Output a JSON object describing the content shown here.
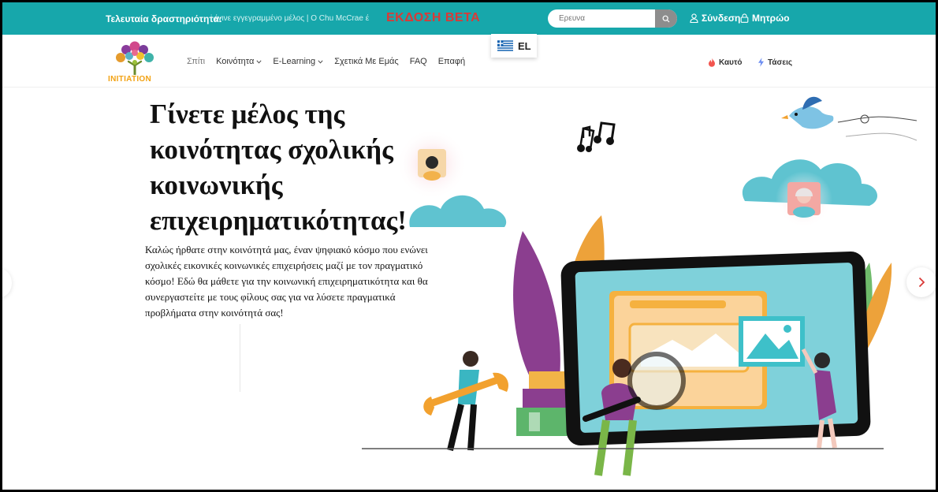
{
  "topbar": {
    "activity_label": "Τελευταία δραστηριότητα:",
    "activity_text": "i έγινε εγγεγραμμένο μέλος | O Chu McCrae έ",
    "beta_label": "ΕΚΔΟΣΗ BETA",
    "search_placeholder": "Ερευνα",
    "login_label": "Σύνδεση",
    "register_label": "Μητρώο"
  },
  "language": {
    "code": "EL"
  },
  "nav": {
    "logo_text": "INITIATION",
    "items": [
      {
        "label": "Σπίτι",
        "dropdown": false
      },
      {
        "label": "Κοινότητα",
        "dropdown": true
      },
      {
        "label": "E-Learning",
        "dropdown": true
      },
      {
        "label": "Σχετικά Με Εμάς",
        "dropdown": false
      },
      {
        "label": "FAQ",
        "dropdown": false
      },
      {
        "label": "Επαφή",
        "dropdown": false
      }
    ],
    "hot_label": "Καυτό",
    "trends_label": "Τάσεις"
  },
  "hero": {
    "title_lines": [
      "Γίνετε μέλος της",
      "κοινότητας σχολικής",
      "κοινωνικής",
      "επιχειρηματικότητας!"
    ],
    "description": "Καλώς ήρθατε στην κοινότητά μας, έναν ψηφιακό κόσμο που ενώνει σχολικές εικονικές κοινωνικές επιχειρήσεις μαζί με τον πραγματικό κόσμο! Εδώ θα μάθετε για την κοινωνική επιχειρηματικότητα και θα συνεργαστείτε με τους φίλους σας για να λύσετε πραγματικά προβλήματα στην κοινότητά σας!"
  },
  "colors": {
    "topbar": "#17a7ab",
    "beta": "#d93a37",
    "logo_text": "#f2a213",
    "search_button": "#8d8d8d"
  },
  "icons": {
    "search": "search-icon",
    "login": "user-icon",
    "register": "lock-icon",
    "hot": "fire-icon",
    "trends": "lightning-icon",
    "next": "chevron-right-icon",
    "language": "greek-flag-icon"
  }
}
